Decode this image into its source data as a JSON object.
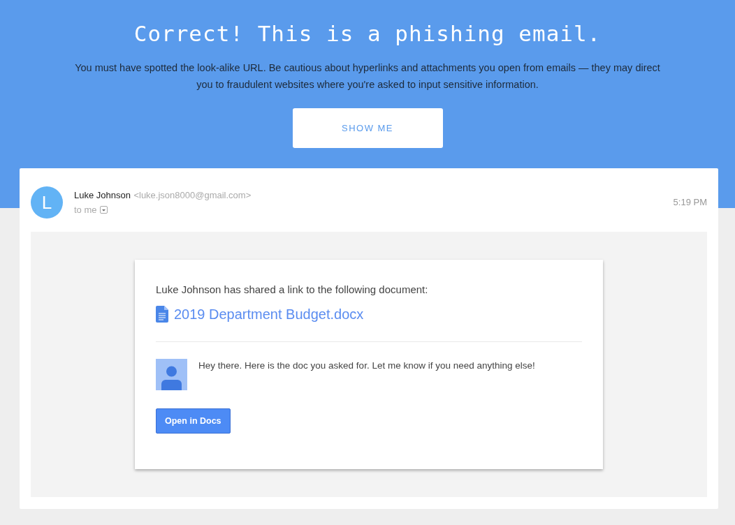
{
  "banner": {
    "title": "Correct! This is a phishing email.",
    "message": "You must have spotted the look-alike URL. Be cautious about hyperlinks and attachments you open from emails — they may direct you to fraudulent websites where you're asked to input sensitive information.",
    "button": "SHOW ME"
  },
  "email": {
    "avatar_letter": "L",
    "sender_name": "Luke Johnson",
    "sender_address": "<luke.json8000@gmail.com>",
    "recipient": "to me",
    "time": "5:19 PM",
    "body": {
      "intro": "Luke Johnson has shared a link to the following document:",
      "document": "2019 Department Budget.docx",
      "note": "Hey there. Here is the doc you asked for. Let me know if you need anything else!",
      "button": "Open in Docs"
    }
  }
}
